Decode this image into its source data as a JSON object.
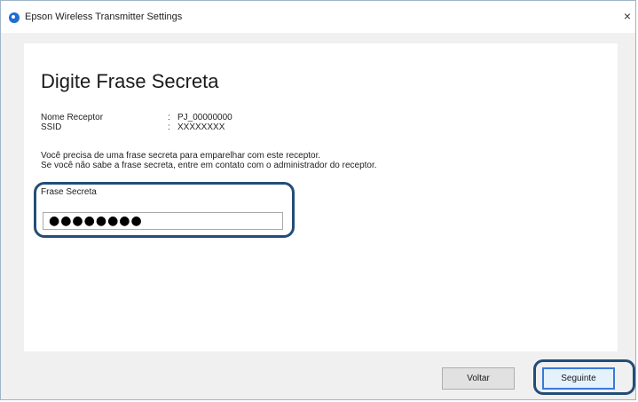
{
  "window": {
    "title": "Epson Wireless Transmitter Settings",
    "close_glyph": "×"
  },
  "page": {
    "title": "Digite Frase Secreta",
    "info": [
      {
        "label": "Nome Receptor",
        "colon": ":",
        "value": "PJ_00000000"
      },
      {
        "label": "SSID",
        "colon": ":",
        "value": "XXXXXXXX"
      }
    ],
    "message_line1": "Você precisa de uma frase secreta para emparelhar com este receptor.",
    "message_line2": "Se você não sabe a frase secreta, entre em contato com o administrador do receptor.",
    "passphrase_label": "Frase Secreta",
    "passphrase_value": "●●●●●●●●"
  },
  "buttons": {
    "back_label": "Voltar",
    "next_label": "Seguinte"
  },
  "colors": {
    "accent": "#3b79d8",
    "highlight": "#234d78"
  },
  "icons": {
    "app": "epson-app-icon",
    "close": "close-icon"
  }
}
